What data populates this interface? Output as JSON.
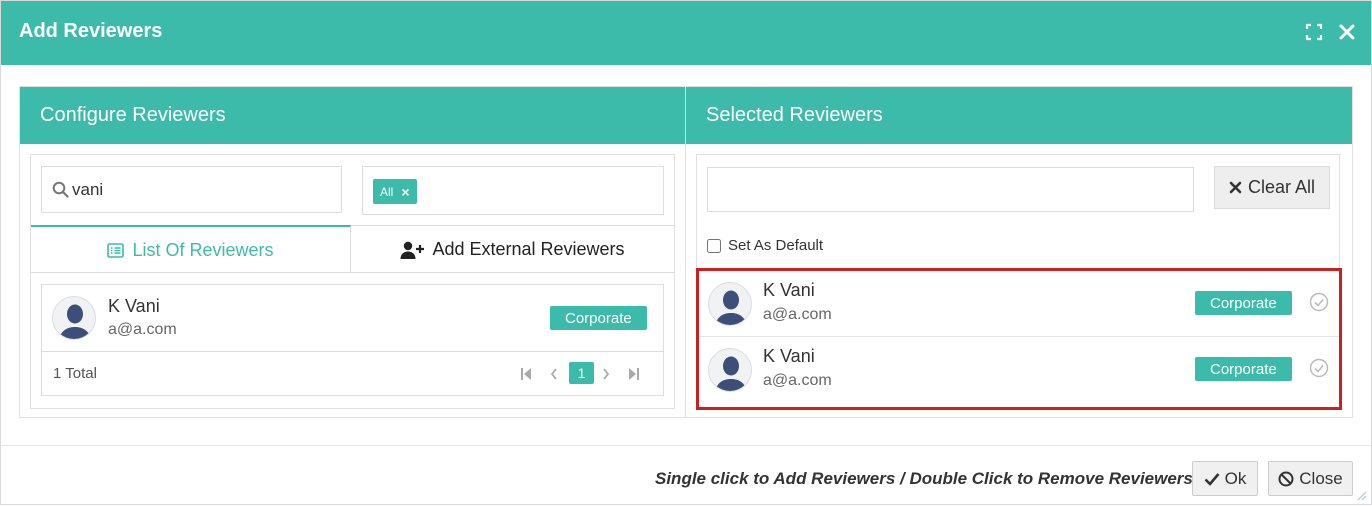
{
  "modal": {
    "title": "Add Reviewers"
  },
  "configure": {
    "title": "Configure Reviewers",
    "search_value": "vani",
    "filter_tag": "All",
    "tabs": [
      {
        "label": "List Of Reviewers",
        "active": true
      },
      {
        "label": "Add External Reviewers",
        "active": false
      }
    ],
    "results": [
      {
        "name": "K Vani",
        "email": "a@a.com",
        "type": "Corporate"
      }
    ],
    "total_label": "1 Total",
    "current_page": "1"
  },
  "selected": {
    "title": "Selected Reviewers",
    "input_value": "",
    "clear_all_label": "Clear All",
    "set_default_label": "Set As Default",
    "items": [
      {
        "name": "K Vani",
        "email": "a@a.com",
        "type": "Corporate"
      },
      {
        "name": "K Vani",
        "email": "a@a.com",
        "type": "Corporate"
      }
    ]
  },
  "footer": {
    "hint": "Single click to Add Reviewers / Double Click to Remove Reviewers",
    "ok_label": "Ok",
    "close_label": "Close"
  },
  "colors": {
    "accent": "#3cbbab",
    "highlight_border": "#cc1f1f"
  }
}
